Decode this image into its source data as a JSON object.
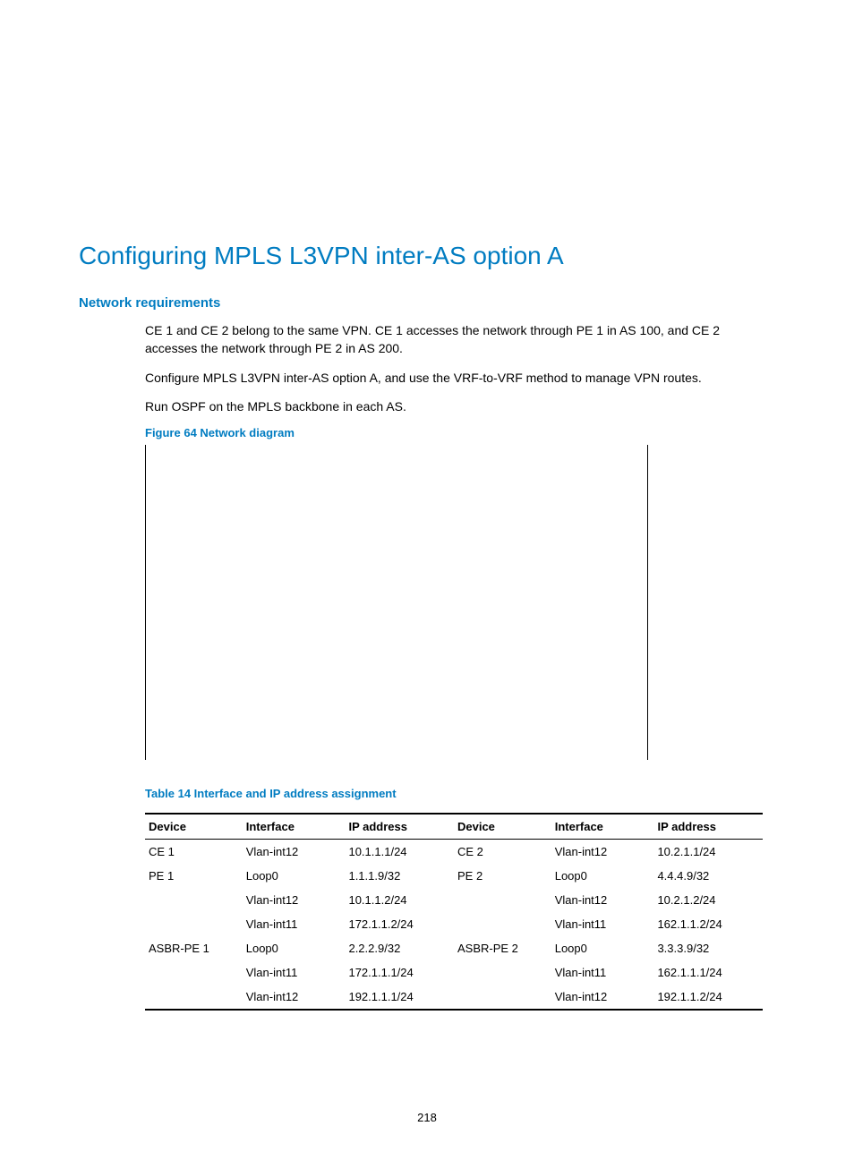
{
  "title": "Configuring MPLS L3VPN inter-AS option A",
  "section_heading": "Network requirements",
  "paragraphs": {
    "p1": "CE 1 and CE 2 belong to the same VPN. CE 1 accesses the network through PE 1 in AS 100, and CE 2 accesses the network through PE 2 in AS 200.",
    "p2": "Configure MPLS L3VPN inter-AS option A, and use the VRF-to-VRF method to manage VPN routes.",
    "p3": "Run OSPF on the MPLS backbone in each AS."
  },
  "figure_caption": "Figure 64 Network diagram",
  "table_caption": "Table 14 Interface and IP address assignment",
  "table": {
    "headers": [
      "Device",
      "Interface",
      "IP address",
      "Device",
      "Interface",
      "IP address"
    ],
    "rows": [
      [
        "CE 1",
        "Vlan-int12",
        "10.1.1.1/24",
        "CE 2",
        "Vlan-int12",
        "10.2.1.1/24"
      ],
      [
        "PE 1",
        "Loop0",
        "1.1.1.9/32",
        "PE 2",
        "Loop0",
        "4.4.4.9/32"
      ],
      [
        "",
        "Vlan-int12",
        "10.1.1.2/24",
        "",
        "Vlan-int12",
        "10.2.1.2/24"
      ],
      [
        "",
        "Vlan-int11",
        "172.1.1.2/24",
        "",
        "Vlan-int11",
        "162.1.1.2/24"
      ],
      [
        "ASBR-PE 1",
        "Loop0",
        "2.2.2.9/32",
        "ASBR-PE 2",
        "Loop0",
        "3.3.3.9/32"
      ],
      [
        "",
        "Vlan-int11",
        "172.1.1.1/24",
        "",
        "Vlan-int11",
        "162.1.1.1/24"
      ],
      [
        "",
        "Vlan-int12",
        "192.1.1.1/24",
        "",
        "Vlan-int12",
        "192.1.1.2/24"
      ]
    ]
  },
  "page_number": "218"
}
